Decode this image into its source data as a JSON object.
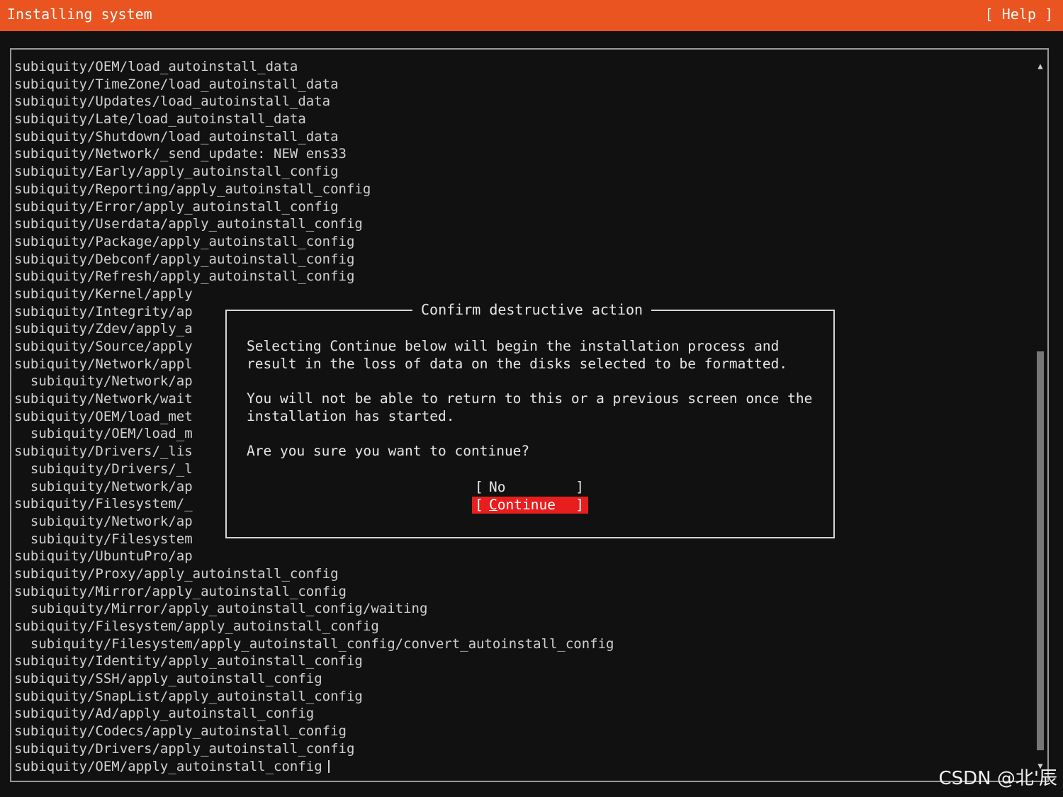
{
  "header": {
    "title": "Installing system",
    "help": "[ Help ]"
  },
  "log_lines": [
    "subiquity/OEM/load_autoinstall_data",
    "subiquity/TimeZone/load_autoinstall_data",
    "subiquity/Updates/load_autoinstall_data",
    "subiquity/Late/load_autoinstall_data",
    "subiquity/Shutdown/load_autoinstall_data",
    "subiquity/Network/_send_update: NEW ens33",
    "subiquity/Early/apply_autoinstall_config",
    "subiquity/Reporting/apply_autoinstall_config",
    "subiquity/Error/apply_autoinstall_config",
    "subiquity/Userdata/apply_autoinstall_config",
    "subiquity/Package/apply_autoinstall_config",
    "subiquity/Debconf/apply_autoinstall_config",
    "subiquity/Refresh/apply_autoinstall_config",
    "subiquity/Kernel/apply",
    "subiquity/Integrity/ap",
    "subiquity/Zdev/apply_a",
    "subiquity/Source/apply",
    "subiquity/Network/appl",
    "  subiquity/Network/ap",
    "subiquity/Network/wait",
    "subiquity/OEM/load_met",
    "  subiquity/OEM/load_m",
    "subiquity/Drivers/_lis",
    "  subiquity/Drivers/_l",
    "  subiquity/Network/ap",
    "subiquity/Filesystem/_",
    "  subiquity/Network/ap",
    "  subiquity/Filesystem",
    "subiquity/UbuntuPro/ap",
    "subiquity/Proxy/apply_autoinstall_config",
    "subiquity/Mirror/apply_autoinstall_config",
    "  subiquity/Mirror/apply_autoinstall_config/waiting",
    "subiquity/Filesystem/apply_autoinstall_config",
    "  subiquity/Filesystem/apply_autoinstall_config/convert_autoinstall_config",
    "subiquity/Identity/apply_autoinstall_config",
    "subiquity/SSH/apply_autoinstall_config",
    "subiquity/SnapList/apply_autoinstall_config",
    "subiquity/Ad/apply_autoinstall_config",
    "subiquity/Codecs/apply_autoinstall_config",
    "subiquity/Drivers/apply_autoinstall_config",
    "subiquity/OEM/apply_autoinstall_config"
  ],
  "scrollbar": {
    "up_icon": "▲",
    "down_icon": "▼",
    "thumb_position_fraction": 0.41,
    "thumb_size_fraction": 0.56
  },
  "dialog": {
    "title": "Confirm destructive action",
    "paragraph1": "Selecting Continue below will begin the installation process and\nresult in the loss of data on the disks selected to be formatted.",
    "paragraph2": "You will not be able to return to this or a previous screen once the\ninstallation has started.",
    "question": "Are you sure you want to continue?",
    "buttons": {
      "no": "No",
      "continue": "Continue",
      "bracket_left": "[",
      "bracket_right": "]"
    }
  },
  "colors": {
    "header_bg": "#e95420",
    "continue_bg": "#e81e1e",
    "terminal_bg": "#111111"
  },
  "watermark": "CSDN @北'辰"
}
